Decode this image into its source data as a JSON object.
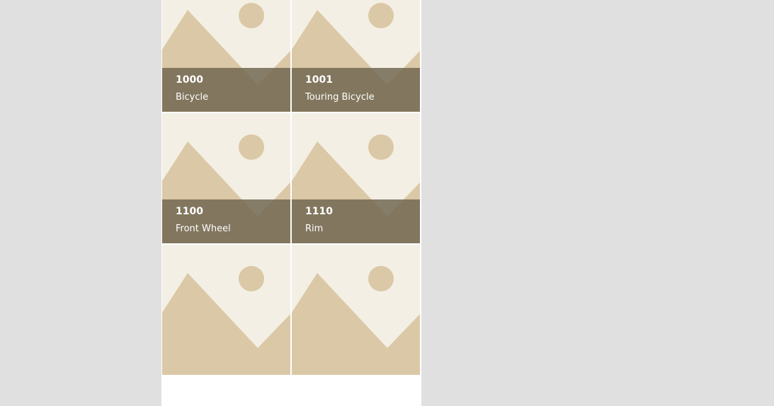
{
  "colors": {
    "page_background": "#e0e0e0",
    "gallery_background": "#ffffff",
    "tile_background": "#f3efe4",
    "placeholder_shape": "#dbc8a6",
    "caption_overlay": "#847865",
    "caption_text": "#ffffff"
  },
  "gallery": {
    "items": [
      {
        "number": "1000",
        "name": "Bicycle",
        "icon": "image-placeholder-icon"
      },
      {
        "number": "1001",
        "name": "Touring Bicycle",
        "icon": "image-placeholder-icon"
      },
      {
        "number": "1100",
        "name": "Front Wheel",
        "icon": "image-placeholder-icon"
      },
      {
        "number": "1110",
        "name": "Rim",
        "icon": "image-placeholder-icon"
      },
      {
        "number": "",
        "name": "",
        "icon": "image-placeholder-icon"
      },
      {
        "number": "",
        "name": "",
        "icon": "image-placeholder-icon"
      }
    ]
  }
}
